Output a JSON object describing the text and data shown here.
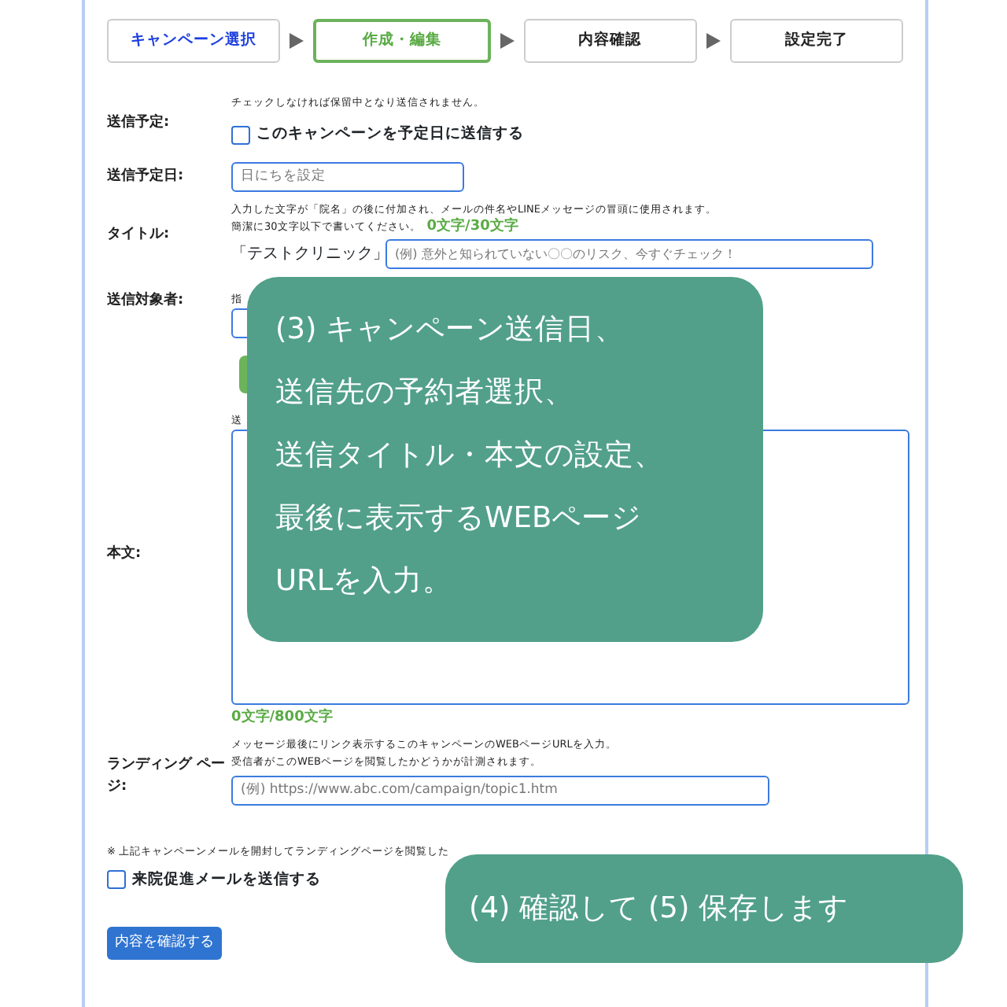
{
  "steps": [
    {
      "label": "キャンペーン選択",
      "completed": true,
      "selected": false
    },
    {
      "label": "作成・編集",
      "completed": false,
      "selected": true
    },
    {
      "label": "内容確認",
      "completed": false,
      "selected": false
    },
    {
      "label": "設定完了",
      "completed": false,
      "selected": false
    }
  ],
  "form": [
    {
      "kind": "checkbox",
      "label": "送信予定:",
      "hints": [
        "チェックしなければ保留中となり送信されません。"
      ],
      "option": "このキャンペーンを予定日に送信する",
      "checked": false
    },
    {
      "kind": "date",
      "label": "送信予定日:",
      "placeholder": "日にちを設定"
    },
    {
      "kind": "title",
      "label": "タイトル:",
      "hints": [
        "入力した文字が「院名」の後に付加され、メールの件名やLINEメッセージの冒頭に使用されます。",
        "簡潔に30文字以下で書いてください。"
      ],
      "counter": "0文字/30文字",
      "prefix": "「テストクリニック」",
      "placeholder": "(例) 意外と知られていない〇〇のリスク、今すぐチェック！"
    },
    {
      "kind": "target",
      "label": "送信対象者:",
      "hints": [
        "指"
      ]
    },
    {
      "kind": "body",
      "label": "本文:",
      "hints": [
        "送"
      ],
      "counter": "0文字/800文字"
    },
    {
      "kind": "url",
      "label": "ランディング ページ:",
      "hints": [
        "メッセージ最後にリンク表示するこのキャンペーンのWEBページURLを入力。",
        "受信者がこのWEBページを閲覧したかどうかが計測されます。"
      ],
      "placeholder": "(例) https://www.abc.com/campaign/topic1.htm"
    }
  ],
  "note": "※ 上記キャンペーンメールを開封してランディングページを閲覧した",
  "followup": {
    "label": "来院促進メールを送信する",
    "checked": false
  },
  "confirm_button": "内容を確認する",
  "callouts": [
    {
      "lines": [
        "(3) キャンペーン送信日、",
        "送信先の予約者選択、",
        "送信タイトル・本文の設定、",
        "最後に表示するWEBページ",
        "URLを入力。"
      ]
    },
    {
      "lines": [
        "(4) 確認して (5) 保存します"
      ]
    }
  ]
}
